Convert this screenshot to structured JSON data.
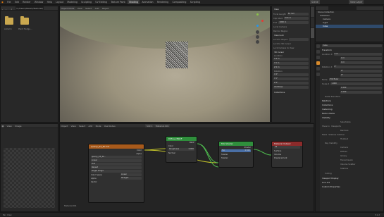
{
  "menu": {
    "app_icon": "blender-icon",
    "items": [
      "File",
      "Edit",
      "Render",
      "Window",
      "Help"
    ]
  },
  "workspaces": [
    "Layout",
    "Modeling",
    "Sculpting",
    "UV Editing",
    "Texture Paint",
    "Shading",
    "Animation",
    "Rendering",
    "Compositing",
    "Scripting"
  ],
  "active_workspace": "Shading",
  "scene_label": "Scene",
  "view_layer_label": "View Layer",
  "file_browser": {
    "path": "C:/Users/Steam/Textures/",
    "folders": [
      {
        "label": "Autumn"
      },
      {
        "label": "Plant Hedge..."
      }
    ]
  },
  "viewport": {
    "mode": "Object Mode",
    "menu": [
      "View",
      "Select",
      "Add",
      "Object"
    ],
    "sidebar": {
      "tabs": [
        "Item",
        "Tool",
        "View"
      ],
      "view_section": "View",
      "focal_label": "Focal Length",
      "focal_value": "50 mm",
      "clip_start_label": "Clip Start",
      "clip_start_value": "0.01 m",
      "clip_end_label": "End",
      "clip_end_value": "1000 m",
      "local_camera": "Local Camera",
      "render_region": "Render Region",
      "lock_section": "View Lock",
      "lock_to_object": "Lock to Object",
      "lock_to_3d_cursor": "Lock to 3D Cursor",
      "lock_camera_to_view": "Lock Camera to View",
      "cursor_section": "3D Cursor",
      "location_label": "Location",
      "loc": [
        "X 0 m",
        "Y 0 m",
        "Z 0 m"
      ],
      "rotation_label": "Rotation",
      "rot": [
        "X 0°",
        "Y 0°",
        "Z 0°"
      ],
      "rot_mode": "XYZ Euler",
      "collections_section": "Collections"
    }
  },
  "node_editor": {
    "header": [
      "Object",
      "View",
      "Select",
      "Add",
      "Node",
      "Use Nodes"
    ],
    "slot": "Slot 1",
    "material": "Material.001",
    "label": "Material.001",
    "image_node": {
      "title": "quarry_03_4k.hdr",
      "out_color": "Color",
      "out_alpha": "Alpha",
      "image_name": "quarry_03_4k...",
      "interp": "Linear",
      "projection": "Flat",
      "extension": "Repeat",
      "source": "Single Image",
      "color_space_label": "Color Space",
      "color_space": "Linear",
      "alpha_label": "Alpha",
      "alpha_value": "Straight",
      "vector": "Vector"
    },
    "diffuse_node": {
      "title": "Diffuse BSDF",
      "out": "BSDF",
      "in_color": "Color",
      "roughness_label": "Roughness",
      "roughness_value": "0.000",
      "in_normal": "Normal"
    },
    "mix_node": {
      "title": "Mix Shader",
      "out": "Shader",
      "fac_label": "Fac",
      "fac_value": "0.500",
      "in_shader_1": "Shader",
      "in_shader_2": "Shader"
    },
    "output_node": {
      "title": "Material Output",
      "target": "All",
      "in_surface": "Surface",
      "in_volume": "Volume",
      "in_displacement": "Displacement"
    }
  },
  "image_editor": {
    "header": [
      "View",
      "Image"
    ]
  },
  "outliner": {
    "title": "Scene Collection",
    "rows": [
      {
        "label": "Collection",
        "icon": "collection-icon",
        "selected": false
      },
      {
        "label": "Camera",
        "icon": "camera-icon",
        "selected": false
      },
      {
        "label": "Light",
        "icon": "light-icon",
        "selected": false
      },
      {
        "label": "Cube",
        "icon": "mesh-icon",
        "selected": true
      }
    ]
  },
  "properties": {
    "object_name": "Cube",
    "transform_section": "Transform",
    "location_label": "Location X",
    "location_values": [
      "0 m",
      "0 m",
      "0 m"
    ],
    "rotation_label": "Rotation X",
    "rotation_values": [
      "0°",
      "0°",
      "0°"
    ],
    "mode_label": "Mode",
    "mode_value": "XYZ Euler",
    "scale_label": "Scale X",
    "scale_values": [
      "1.000",
      "1.000",
      "1.000"
    ],
    "sections": [
      "Delta Transform",
      "Relations",
      "Collections",
      "Instancing",
      "Motion Paths",
      "Visibility",
      "Viewport Display",
      "Line Art",
      "Custom Properties"
    ],
    "visibility": {
      "selectable": "Selectable",
      "show_in_label": "Show In",
      "viewports": "Viewports",
      "renders": "Renders",
      "mask_label": "Mask",
      "shadow_catcher": "Shadow Catcher",
      "holdout": "Holdout",
      "ray_visibility": "Ray Visibility",
      "camera": "Camera",
      "diffuse": "Diffuse",
      "glossy": "Glossy",
      "transmission": "Transmission",
      "volume_scatter": "Volume Scatter",
      "shadow": "Shadow",
      "culling": "Culling"
    }
  },
  "status_bar": {
    "left": "Pan View",
    "right": "3.1.2"
  }
}
